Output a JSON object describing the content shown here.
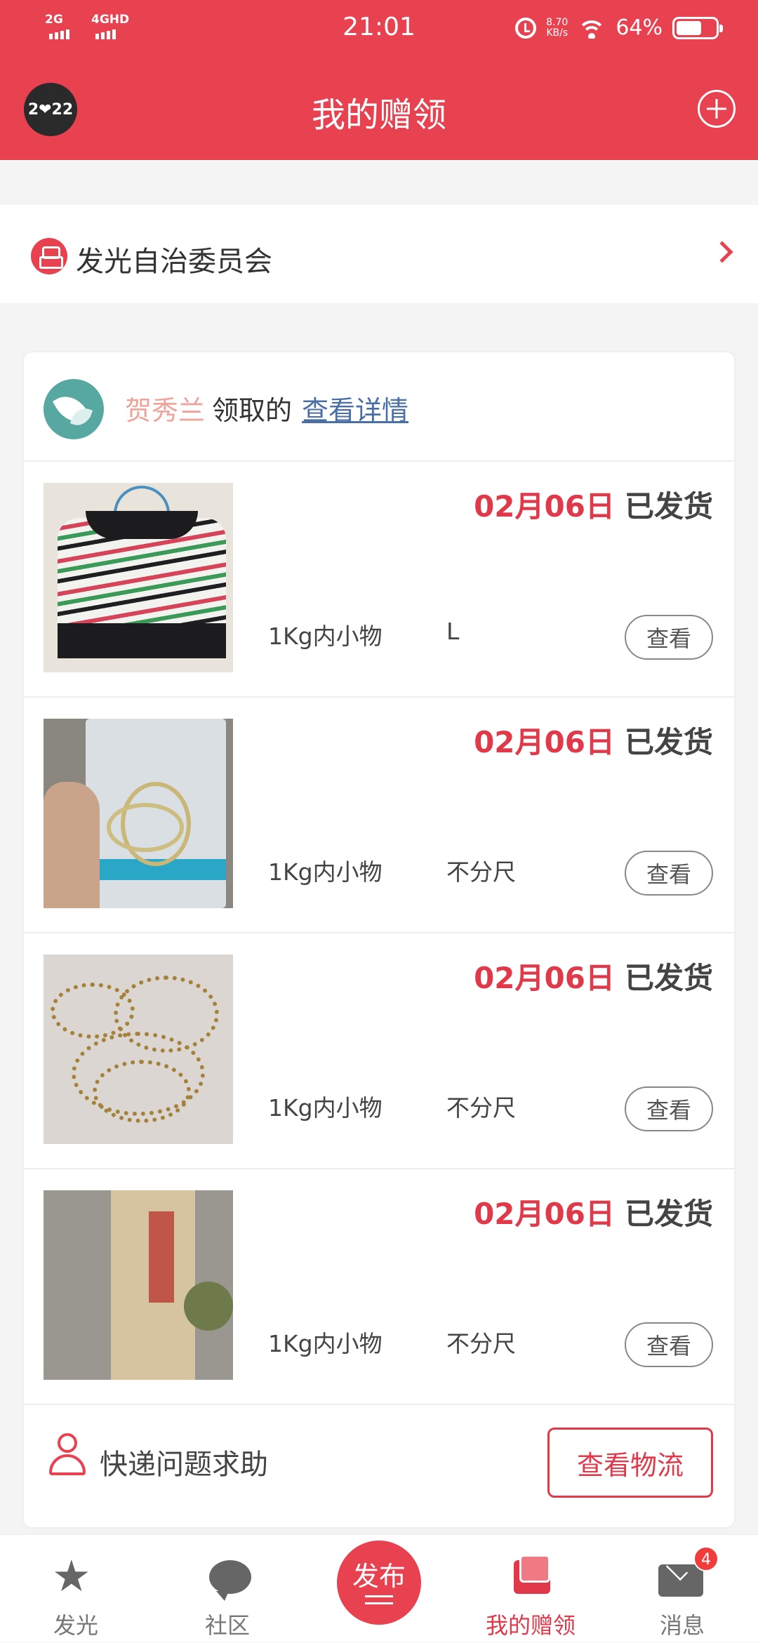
{
  "status_bar": {
    "sim1": "2G",
    "sim2": "4GHD",
    "time": "21:01",
    "net_speed_value": "8.70",
    "net_speed_unit": "KB/s",
    "battery": "64%"
  },
  "header": {
    "badge": "2❤22",
    "title": "我的赠领"
  },
  "committee": {
    "label": "发光自治委员会"
  },
  "card": {
    "receiver_name": "贺秀兰",
    "receiver_suffix": "领取的",
    "detail_link": "查看详情",
    "items": [
      {
        "date": "02月06日",
        "status": "已发货",
        "weight": "1Kg内小物",
        "size": "L",
        "button": "查看"
      },
      {
        "date": "02月06日",
        "status": "已发货",
        "weight": "1Kg内小物",
        "size": "不分尺",
        "button": "查看"
      },
      {
        "date": "02月06日",
        "status": "已发货",
        "weight": "1Kg内小物",
        "size": "不分尺",
        "button": "查看"
      },
      {
        "date": "02月06日",
        "status": "已发货",
        "weight": "1Kg内小物",
        "size": "不分尺",
        "button": "查看"
      }
    ],
    "help_label": "快递问题求助",
    "logistics_button": "查看物流"
  },
  "bottom_nav": {
    "items": [
      {
        "label": "发光",
        "icon": "star-icon"
      },
      {
        "label": "社区",
        "icon": "chat-icon"
      },
      {
        "label": "发布",
        "icon": "publish-icon"
      },
      {
        "label": "我的赠领",
        "icon": "gift-icon",
        "active": true
      },
      {
        "label": "消息",
        "icon": "mail-icon",
        "badge": "4"
      }
    ]
  },
  "colors": {
    "brand": "#e84150",
    "date": "#e03a4a",
    "receiver": "#f0a39a",
    "link": "#4a6fa5"
  }
}
